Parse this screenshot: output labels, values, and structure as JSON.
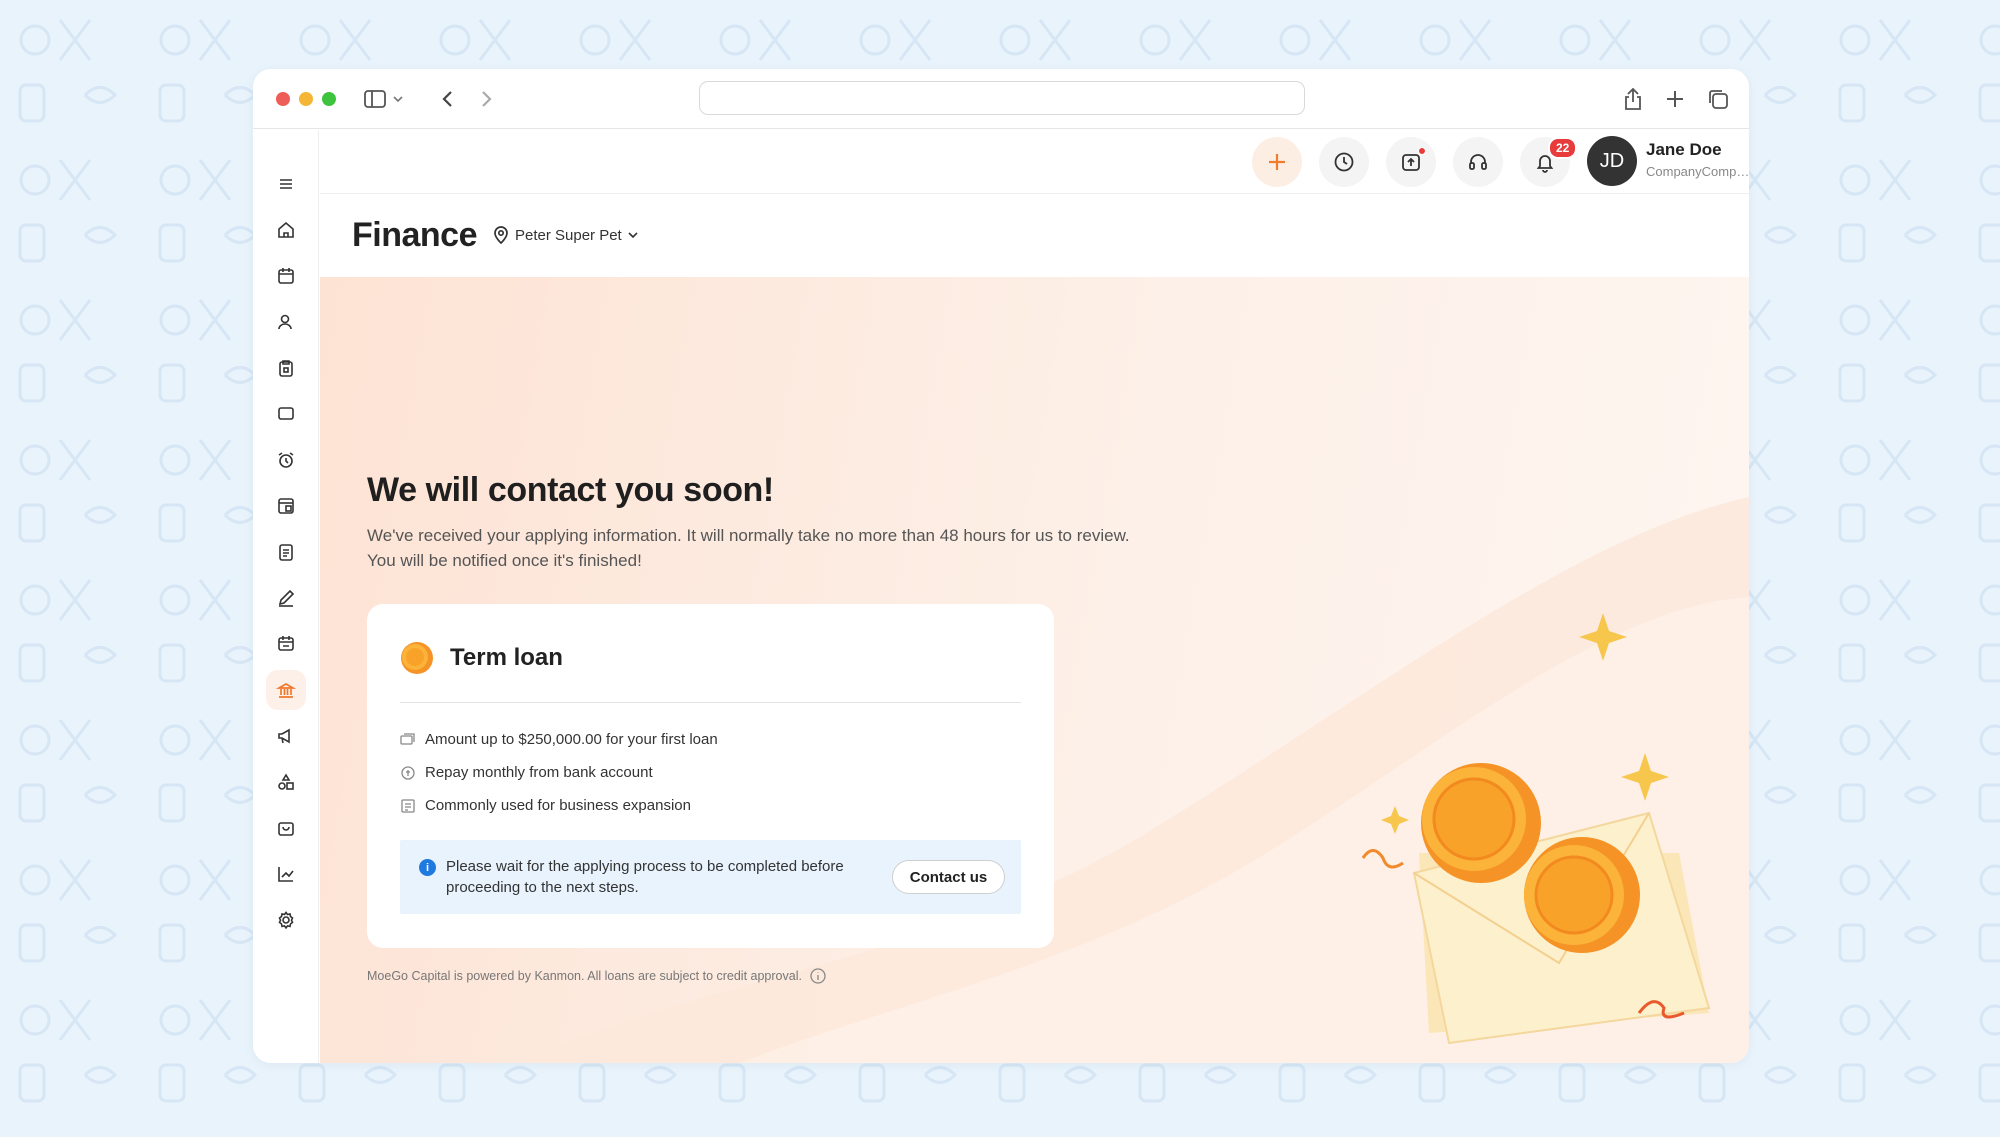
{
  "browser": {
    "traffic_colors": [
      "#ee5d57",
      "#f5b637",
      "#3ec33e"
    ]
  },
  "sidebar": {
    "items": [
      {
        "icon": "menu-icon"
      },
      {
        "icon": "home-icon"
      },
      {
        "icon": "calendar-icon"
      },
      {
        "icon": "client-icon"
      },
      {
        "icon": "clipboard-lock-icon"
      },
      {
        "icon": "message-icon"
      },
      {
        "icon": "alarm-icon"
      },
      {
        "icon": "calendar-card-icon"
      },
      {
        "icon": "checklist-icon"
      },
      {
        "icon": "pen-icon"
      },
      {
        "icon": "schedule-icon"
      },
      {
        "icon": "bank-icon",
        "active": true
      },
      {
        "icon": "megaphone-icon"
      },
      {
        "icon": "shapes-icon"
      },
      {
        "icon": "shopping-bag-icon"
      },
      {
        "icon": "chart-icon"
      },
      {
        "icon": "settings-icon"
      }
    ]
  },
  "header": {
    "notification_count": "22",
    "avatar_initials": "JD",
    "user_name": "Jane Doe",
    "company": "CompanyCompany"
  },
  "page": {
    "title": "Finance",
    "location": "Peter Super Pet"
  },
  "main": {
    "headline": "We will contact you soon!",
    "subtext_line1": "We've received your applying information. It will normally take no more than 48 hours for us to review.",
    "subtext_line2": "You will be notified once it's finished!",
    "card": {
      "title": "Term loan",
      "features": [
        "Amount up to $250,000.00 for your first loan",
        "Repay monthly from bank account",
        "Commonly used for business expansion"
      ],
      "info_text": "Please wait for the applying process to be completed before proceeding to the next steps.",
      "contact_label": "Contact us"
    },
    "footnote": "MoeGo Capital is powered by Kanmon. All loans are subject to credit approval."
  },
  "colors": {
    "accent": "#f0782d",
    "info_blue": "#1f7ae0",
    "badge_red": "#e83b3b"
  }
}
